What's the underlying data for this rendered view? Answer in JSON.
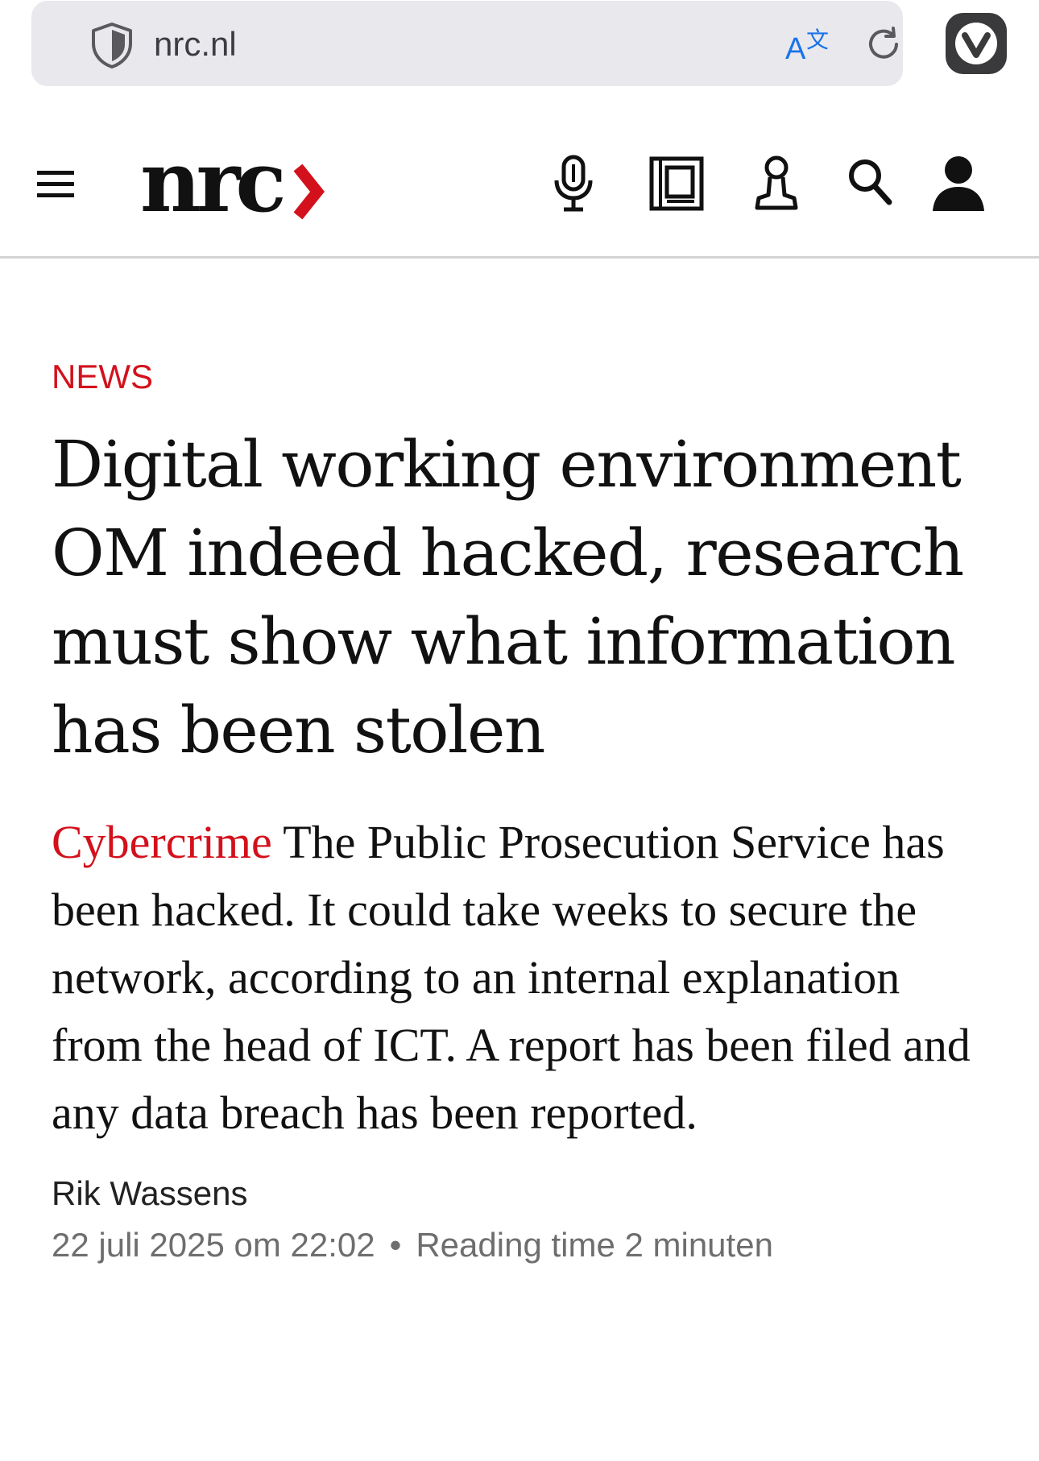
{
  "browser": {
    "url": "nrc.nl",
    "icons": {
      "security": "shield-icon",
      "translate": "translate-icon",
      "reload": "reload-icon",
      "browser_menu": "vivaldi-icon"
    },
    "accent_color": "#1a73e8"
  },
  "site_header": {
    "logo_text": "nrc",
    "logo_chevron": "›",
    "brand_color": "#d3111c",
    "icons": [
      "menu-icon",
      "microphone-icon",
      "newspaper-icon",
      "puzzle-piece-icon",
      "search-icon",
      "account-icon"
    ]
  },
  "article": {
    "category": "NEWS",
    "headline": "Digital working environment OM indeed hacked, research must show what information has been stolen",
    "lead_kicker": "Cybercrime",
    "lead_text": "The Public Prosecution Service has been hacked. It could take weeks to secure the network, according to an internal explanation from the head of ICT. A report has been filed and any data breach has been reported.",
    "author": "Rik Wassens",
    "date": "22 juli 2025 om 22:02",
    "separator": "•",
    "reading_time": "Reading time 2 minuten"
  }
}
